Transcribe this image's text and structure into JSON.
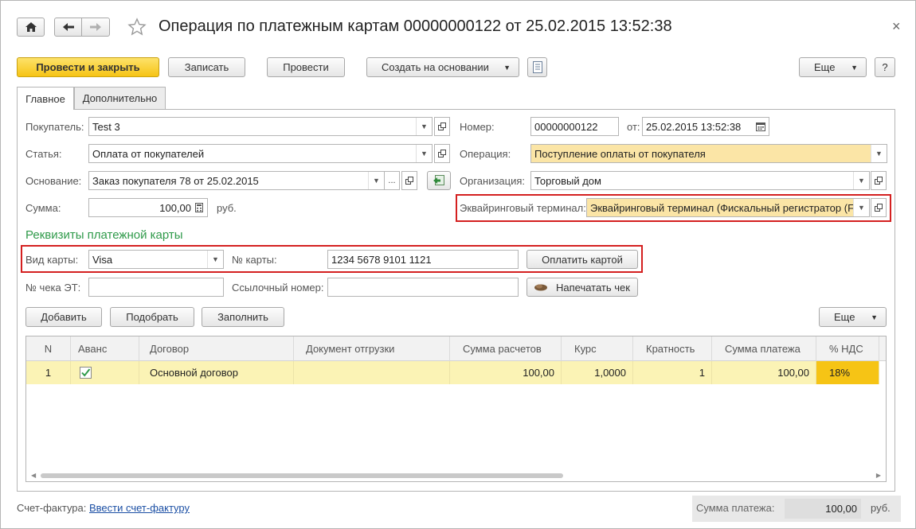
{
  "header": {
    "title": "Операция по платежным картам 00000000122 от 25.02.2015 13:52:38",
    "icons": {
      "home": "home-icon",
      "back": "arrow-left-icon",
      "forward": "arrow-right-icon",
      "favorite": "star-icon",
      "close": "close-icon"
    },
    "close_glyph": "×"
  },
  "toolbar": {
    "post_close": "Провести и закрыть",
    "save": "Записать",
    "post": "Провести",
    "create_based": "Создать на основании",
    "more": "Еще",
    "help": "?"
  },
  "tabs": [
    {
      "label": "Главное",
      "active": true
    },
    {
      "label": "Дополнительно",
      "active": false
    }
  ],
  "form": {
    "buyer_label": "Покупатель:",
    "buyer_value": "Test 3",
    "article_label": "Статья:",
    "article_value": "Оплата от покупателей",
    "basis_label": "Основание:",
    "basis_value": "Заказ покупателя 78 от 25.02.2015",
    "basis_dots": "...",
    "sum_label": "Сумма:",
    "sum_value": "100,00",
    "sum_currency": "руб.",
    "number_label": "Номер:",
    "number_value": "00000000122",
    "date_label": "от:",
    "date_value": "25.02.2015 13:52:38",
    "operation_label": "Операция:",
    "operation_value": "Поступление оплаты от покупателя",
    "org_label": "Организация:",
    "org_value": "Торговый дом",
    "terminal_label": "Эквайринговый терминал:",
    "terminal_value": "Эквайринговый терминал  (Фискальный регистратор (F"
  },
  "card_section": {
    "title": "Реквизиты платежной карты",
    "card_type_label": "Вид карты:",
    "card_type_value": "Visa",
    "card_number_label": "№ карты:",
    "card_number_value": "1234 5678 9101 1121",
    "pay_button": "Оплатить картой",
    "receipt_label": "№ чека ЭТ:",
    "receipt_value": "",
    "ref_label": "Ссылочный номер:",
    "ref_value": "",
    "print_button": "Напечатать чек"
  },
  "table_toolbar": {
    "add": "Добавить",
    "pick": "Подобрать",
    "fill": "Заполнить",
    "more": "Еще"
  },
  "table": {
    "columns": [
      "N",
      "Аванс",
      "Договор",
      "Документ отгрузки",
      "Сумма расчетов",
      "Курс",
      "Кратность",
      "Сумма платежа",
      "% НДС"
    ],
    "rows": [
      {
        "n": "1",
        "advance": true,
        "contract": "Основной договор",
        "shipment_doc": "",
        "settlement_sum": "100,00",
        "rate": "1,0000",
        "multiplicity": "1",
        "payment_sum": "100,00",
        "vat": "18%"
      }
    ]
  },
  "footer": {
    "invoice_label": "Счет-фактура:",
    "invoice_link": "Ввести счет-фактуру",
    "total_label": "Сумма платежа:",
    "total_value": "100,00",
    "total_currency": "руб."
  },
  "colors": {
    "primary_button": "#f6c415",
    "section_title": "#2f9a4a",
    "highlight_box": "#d42020",
    "row_highlight": "#fbf3b5",
    "field_yellow": "#fbe5a6",
    "link": "#1b4fa4"
  }
}
